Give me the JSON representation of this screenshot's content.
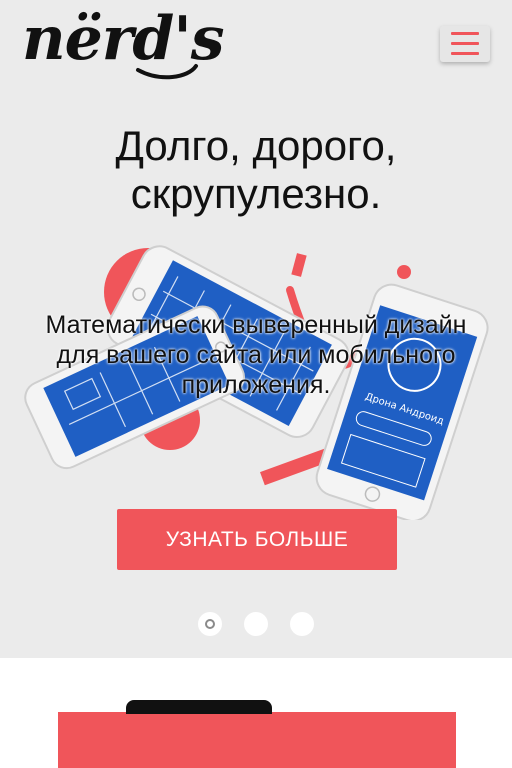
{
  "header": {
    "logo_text": "nërd's",
    "menu_icon": "hamburger-icon"
  },
  "hero": {
    "headline_line1": "Долго, дорого,",
    "headline_line2": "скрупулезно.",
    "subtitle_line1": "Математически выверенный дизайн",
    "subtitle_line2": "для вашего сайта или мобильного",
    "subtitle_line3": "приложения.",
    "cta_label": "УЗНАТЬ БОЛЬШЕ",
    "phone_app_text": "Дрона Андроид",
    "slides": {
      "total": 3,
      "active": 1
    }
  },
  "colors": {
    "accent": "#f0555a",
    "hero_background": "#ebebeb",
    "screen_blue": "#1f5fc4"
  }
}
